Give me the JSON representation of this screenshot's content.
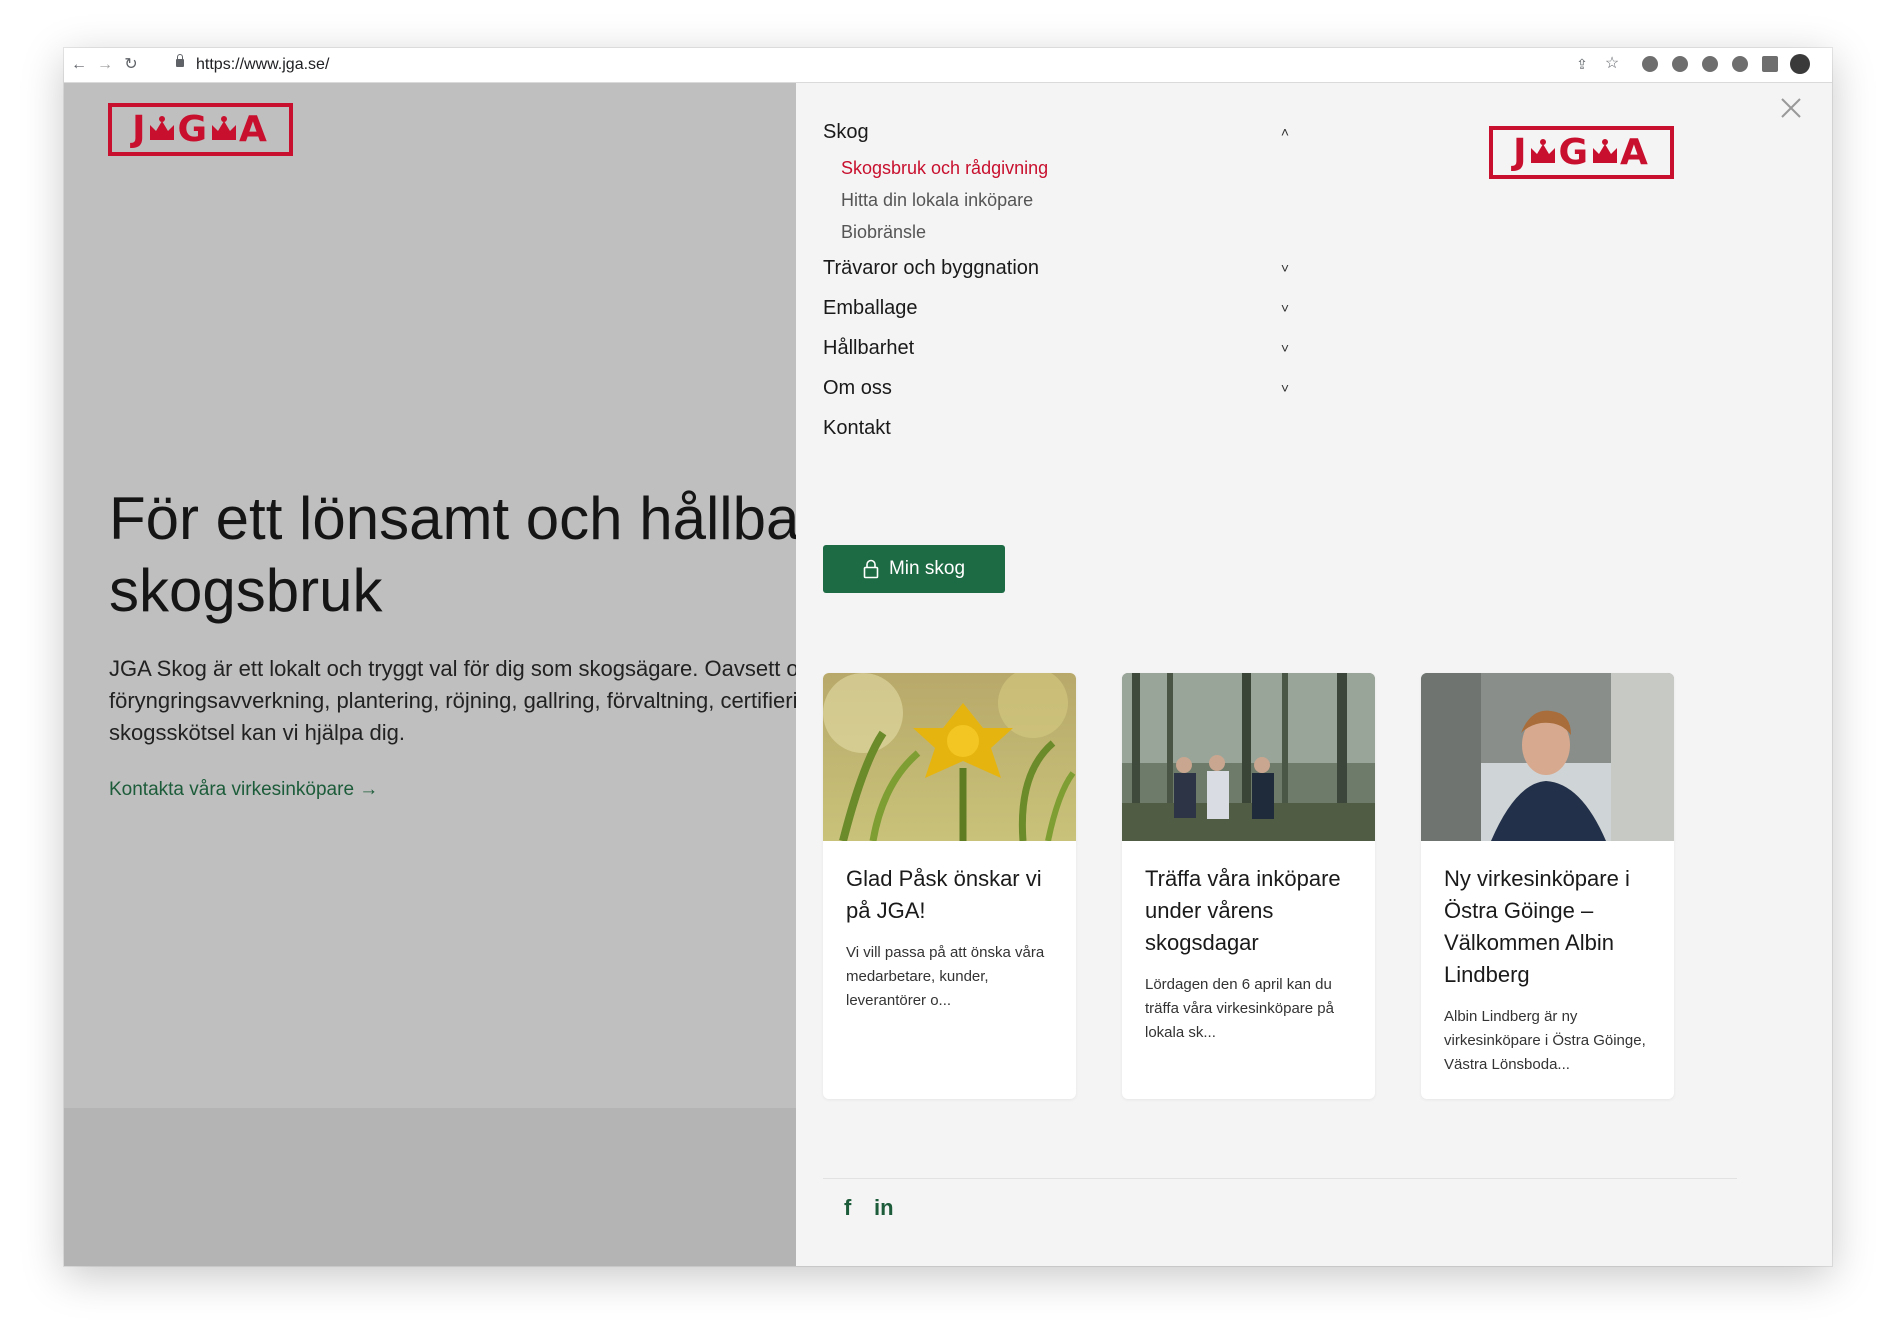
{
  "browser": {
    "url": "https://www.jga.se/",
    "back_icon": "←",
    "forward_icon": "→",
    "reload_icon": "↻",
    "star_icon": "☆",
    "share_icon": "⇪"
  },
  "brand": {
    "color": "#c8102e",
    "green": "#1d6b44"
  },
  "hero": {
    "heading_line1": "För ett lönsamt och hållbart",
    "heading_line2": "skogsbruk",
    "body": "JGA Skog är ett lokalt och tryggt val för dig som skogsägare. Oavsett om det gäller föryngringsavverkning, plantering, röjning, gallring, förvaltning, certifiering eller skogsskötsel kan vi hjälpa dig.",
    "cta": "Kontakta våra virkesinköpare →"
  },
  "menu": {
    "items": [
      {
        "label": "Skog",
        "chevron": "˄"
      },
      {
        "label": "Trävaror och byggnation",
        "chevron": "˅"
      },
      {
        "label": "Emballage",
        "chevron": "˅"
      },
      {
        "label": "Hållbarhet",
        "chevron": "˅"
      },
      {
        "label": "Om oss",
        "chevron": "˅"
      },
      {
        "label": "Kontakt",
        "chevron": ""
      }
    ],
    "skog_sub": [
      "Skogsbruk och rådgivning",
      "Hitta din lokala inköpare",
      "Biobränsle"
    ],
    "min_skog_label": "Min skog"
  },
  "cards": [
    {
      "title": "Glad Påsk önskar vi på JGA!",
      "excerpt": "Vi vill passa på att önska våra medarbetare, kunder, leverantörer o..."
    },
    {
      "title": "Träffa våra inköpare under vårens skogsdagar",
      "excerpt": "Lördagen den 6 april kan du träffa våra virkesinköpare på lokala sk..."
    },
    {
      "title": "Ny virkesinköpare i Östra Göinge – Välkommen Albin Lindberg",
      "excerpt": "Albin Lindberg är ny virkesinköpare i Östra Göinge, Västra Lönsboda..."
    }
  ],
  "social": {
    "facebook": "f",
    "linkedin": "in"
  }
}
